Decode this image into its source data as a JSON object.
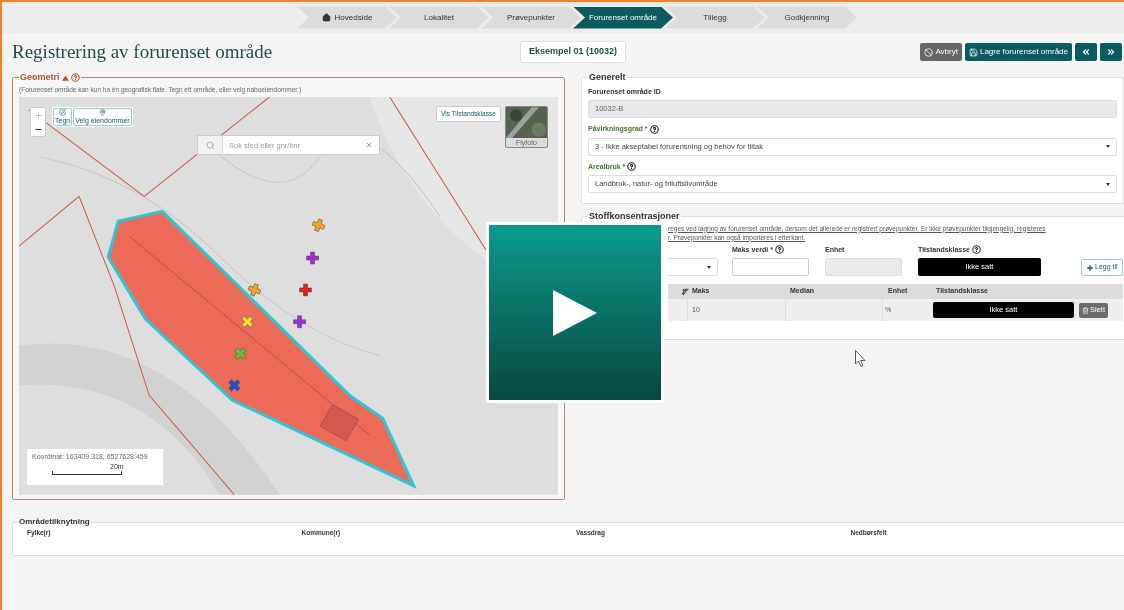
{
  "breadcrumb": [
    {
      "label": "Hovedside",
      "kind": "home",
      "selected": false
    },
    {
      "label": "Lokalitet",
      "kind": "step",
      "selected": false
    },
    {
      "label": "Prøvepunkter",
      "kind": "step",
      "selected": false
    },
    {
      "label": "Forurenset område",
      "kind": "step",
      "selected": true
    },
    {
      "label": "Tillegg",
      "kind": "step",
      "selected": false
    },
    {
      "label": "Godkjenning",
      "kind": "step",
      "selected": false
    }
  ],
  "title": "Registrering av forurenset område",
  "example": "Eksempel 01 (10032)",
  "actions": [
    {
      "label": "Avbryt",
      "kind": "cancel"
    },
    {
      "label": "Lagre forurenset område",
      "kind": "save"
    },
    {
      "kind": "first"
    },
    {
      "kind": "next"
    }
  ],
  "geometry": {
    "legend": "Geometri",
    "hint": "(Forurenset område kan kun ha én geografisk flate. Tegn ett område, eller velg naboeiendommer.)",
    "map": {
      "tools": [
        {
          "label": "Tegn",
          "kind": "draw"
        },
        {
          "label": "Velg eiendommer",
          "kind": "pick"
        }
      ],
      "search_placeholder": "Sok sted eller gnr/bnr",
      "layer_button": "Vis Tilstandsklasse",
      "basemap": "Flyfoto",
      "coordinates": "Koordinat: 163409.318, 6527628.459",
      "scale": "20m"
    }
  },
  "general": {
    "legend": "Generelt",
    "fields": [
      {
        "label": "Forurenset område ID",
        "kind": "readonly",
        "required": false,
        "help": false,
        "value": "10032-B"
      },
      {
        "label": "Påvirkningsgrad *",
        "kind": "select",
        "required": true,
        "help": true,
        "value": "3 - Ikke akseptabel forurensning og behov for tiltak"
      },
      {
        "label": "Arealbruk *",
        "kind": "select",
        "required": true,
        "help": true,
        "value": "Landbruk-, natur- og friluftslivområde"
      }
    ]
  },
  "concentrations": {
    "legend": "Stoffkonsentrasjoner",
    "note": [
      "reges ved lagring av forurenset område, dersom det allerede er registrert prøvepunkter. Er ikke prøvepunkter tilgjengelig, registeres",
      "r. Prøvepunkter kan også importeres i etterkant."
    ],
    "inputs": [
      {
        "kind": "select"
      },
      {
        "label": "Maks verdi *",
        "kind": "input",
        "help": true
      },
      {
        "label": "Enhet",
        "kind": "readonly",
        "help": false
      },
      {
        "label": "Tilstandsklasse",
        "kind": "class",
        "help": true,
        "value": "Ikke satt"
      }
    ],
    "add_button": "Legg til",
    "columns": [
      "Maks",
      "Median",
      "Enhet",
      "Tilstandsklasse"
    ],
    "rows": [
      {
        "maks": "10",
        "enhet": "%",
        "class": "Ikke satt",
        "action": "Slett"
      }
    ]
  },
  "area_links": {
    "legend": "Områdetilknytning",
    "columns": [
      "Fylke(r)",
      "Kommune(r)",
      "Vassdrag",
      "Nedbørsfelt"
    ]
  }
}
